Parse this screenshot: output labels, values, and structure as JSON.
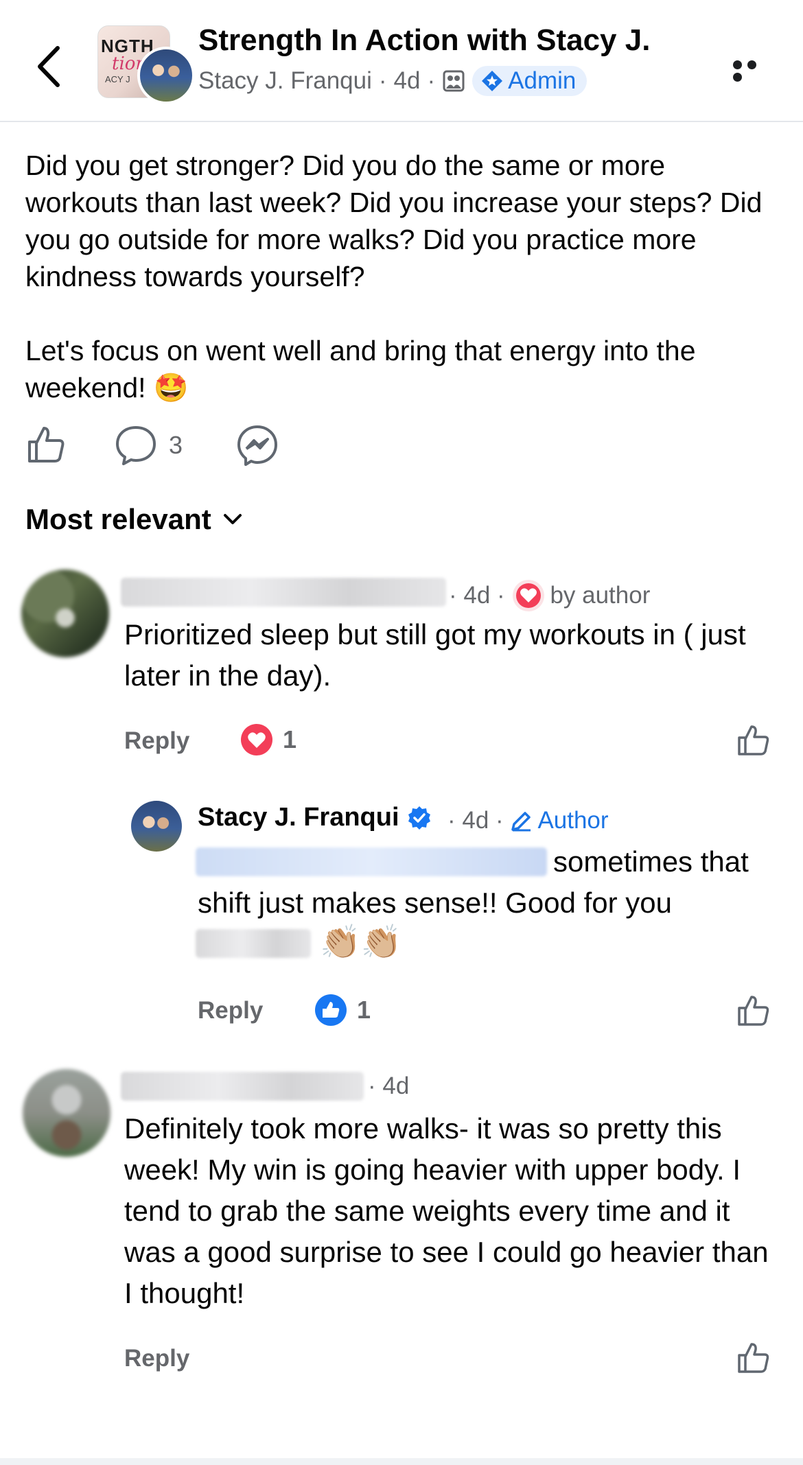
{
  "header": {
    "group_title": "Strength In Action with Stacy J.",
    "author": "Stacy J. Franqui",
    "time": "4d",
    "badge": "Admin",
    "thumb_text_1": "NGTH",
    "thumb_text_2": "tion",
    "thumb_text_3": "ACY J"
  },
  "post": {
    "text": "Did you get stronger? Did you do the same or more workouts than last week? Did you increase your steps? Did you go outside for more walks? Did you practice more kindness towards yourself?\n\nLet's focus on went well and bring that energy into the weekend! 🤩",
    "comment_count": "3"
  },
  "sort_label": "Most relevant",
  "comments": [
    {
      "time": "4d",
      "liked_label": "by author",
      "text": "Prioritized sleep but still got my workouts in ( just later in the day).",
      "reply_label": "Reply",
      "reaction_count": "1",
      "reaction": "love"
    },
    {
      "author": "Stacy J. Franqui",
      "time": "4d",
      "author_badge": "Author",
      "text_part1": "sometimes that",
      "text_line2": "shift just makes sense!! Good for you",
      "emoji": "👏🏼👏🏼",
      "reply_label": "Reply",
      "reaction_count": "1",
      "reaction": "like"
    },
    {
      "time": "4d",
      "text": "Definitely took more walks- it was so pretty this week! My win is going heavier with upper body. I tend to grab the same weights every time and it was a good surprise to see I could go heavier than I thought!",
      "reply_label": "Reply"
    }
  ],
  "colors": {
    "accent": "#1b74e4",
    "admin_pill_bg": "#e7f0fd",
    "secondary_text": "#65676b",
    "love_red": "#f33e58",
    "like_blue": "#1877f2"
  }
}
